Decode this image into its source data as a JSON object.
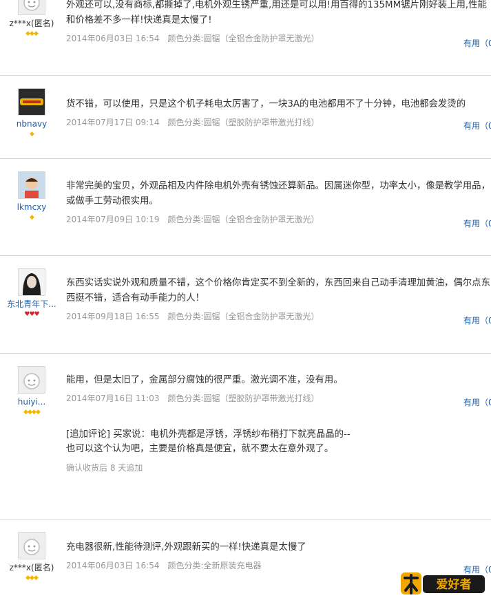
{
  "reviews": [
    {
      "user": "z***x(匿名)",
      "badges": "◆◆◆",
      "text": "外观还可以,没有商标,都撕掉了,电机外观生锈严重,用还是可以用!用百得的135MM锯片刚好装上用,性能和价格差不多一样!快递真是太慢了!",
      "date": "2014年06月03日 16:54",
      "variant": "颜色分类:圆锯（全铝合金防护罩无激光）",
      "useful": "有用（0"
    },
    {
      "user": "nbnavy",
      "badges": "◆",
      "text": "货不错，可以使用，只是这个机子耗电太厉害了，一块3A的电池都用不了十分钟，电池都会发烫的",
      "date": "2014年07月17日 09:14",
      "variant": "颜色分类:圆锯（塑胶防护罩带激光打线）",
      "useful": "有用（0"
    },
    {
      "user": "lkmcxy",
      "badges": "◆",
      "text": "非常完美的宝贝，外观品相及内件除电机外壳有锈蚀还算新品。因属迷你型，功率太小，像是教学用品，或做手工劳动很实用。",
      "date": "2014年07月09日 10:19",
      "variant": "颜色分类:圆锯（全铝合金防护罩无激光）",
      "useful": "有用（0"
    },
    {
      "user": "东北青年下...",
      "badges": "♥♥♥",
      "text": "东西实话实说外观和质量不错，这个价格你肯定买不到全新的，东西回来自己动手清理加黄油，偶尔点东西挺不错，适合有动手能力的人！",
      "date": "2014年09月18日 16:55",
      "variant": "颜色分类:圆锯（全铝合金防护罩无激光）",
      "useful": "有用（0"
    },
    {
      "user": "huiyi...",
      "badges": "◆◆◆◆",
      "text": "能用，但是太旧了，金属部分腐蚀的很严重。激光调不准，没有用。",
      "date": "2014年07月16日 11:03",
      "variant": "颜色分类:圆锯（塑胶防护罩带激光打线）",
      "useful": "有用（0",
      "addition": "[追加评论] 买家说：电机外壳都是浮锈，浮锈纱布稍打下就亮晶晶的--\n也可以这个认为吧，主要是价格真是便宜，就不要太在意外观了。",
      "addition_meta": "确认收货后 8 天追加"
    },
    {
      "user": "z***x(匿名)",
      "badges": "◆◆◆",
      "text": "充电器很新,性能待测评,外观跟新买的一样!快递真是太慢了",
      "date": "2014年06月03日 16:54",
      "variant": "颜色分类:全新原装充电器",
      "useful": "有用（0"
    }
  ],
  "watermark": "木工爱好者",
  "colors": {
    "link": "#1f5ea8",
    "meta": "#999999",
    "divider": "#d6d6d6",
    "gold": "#f5b400",
    "red": "#d8222a"
  }
}
